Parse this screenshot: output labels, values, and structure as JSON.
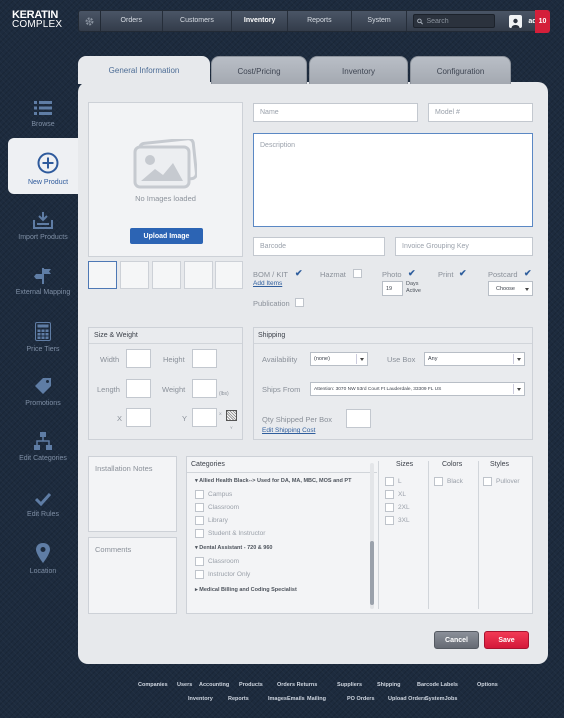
{
  "brand": {
    "line1": "KERATIN",
    "line2": "COMPLEX"
  },
  "nav": {
    "items": [
      "Orders",
      "Customers",
      "Inventory",
      "Reports",
      "System"
    ],
    "active": "Inventory",
    "search_placeholder": "Search",
    "user": "admin",
    "notifications": "10"
  },
  "sidebar": {
    "items": [
      {
        "label": "Browse",
        "icon": "list-icon"
      },
      {
        "label": "New Product",
        "icon": "plus-circle-icon"
      },
      {
        "label": "Import Products",
        "icon": "import-icon"
      },
      {
        "label": "External Mapping",
        "icon": "signpost-icon"
      },
      {
        "label": "Price Tiers",
        "icon": "calculator-icon"
      },
      {
        "label": "Promotions",
        "icon": "tag-icon"
      },
      {
        "label": "Edit Categories",
        "icon": "hierarchy-icon"
      },
      {
        "label": "Edit Rules",
        "icon": "check-icon"
      },
      {
        "label": "Location",
        "icon": "map-pin-icon"
      }
    ],
    "active": "New Product"
  },
  "tabs": [
    "General Information",
    "Cost/Pricing",
    "Inventory",
    "Configuration"
  ],
  "image": {
    "empty_text": "No Images loaded",
    "upload_label": "Upload Image"
  },
  "fields": {
    "name": "Name",
    "model": "Model #",
    "description": "Description",
    "barcode": "Barcode",
    "invoice_key": "Invoice Grouping Key"
  },
  "flags": {
    "bom": "BOM / KIT",
    "add_items": "Add Items",
    "hazmat": "Hazmat",
    "photo": "Photo",
    "days": "19",
    "days_label1": "Days",
    "days_label2": "Active",
    "print": "Print",
    "postcard": "Postcard",
    "choose": "Choose",
    "publication": "Publication"
  },
  "size": {
    "title": "Size & Weight",
    "width": "Width",
    "height": "Height",
    "length": "Length",
    "weight": "Weight",
    "weight_unit": "(lbs)",
    "x1": "X",
    "y": "Y",
    "x2": "X",
    "y2": "Y"
  },
  "shipping": {
    "title": "Shipping",
    "availability": "Availability",
    "availability_value": "(none)",
    "use_box": "Use Box",
    "use_box_value": "Any",
    "ships_from": "Ships From",
    "ships_from_value": "Attention: 3070 NW 53rd Court Ft Lauderdale, 33309 FL US",
    "qty": "Qty  Shipped Per Box",
    "edit_cost": "Edit Shipping Cost"
  },
  "notes": {
    "installation": "Installation Notes",
    "comments": "Comments"
  },
  "categories": {
    "title": "Categories",
    "group1": "Allied Health Black--> Used for DA, MA, MBC, MOS and PT",
    "group1_items": [
      "Campus",
      "Classroom",
      "Library",
      "Student & Instructor"
    ],
    "group2": "Dental Assistant - 720 & 960",
    "group2_items": [
      "Classroom",
      "Instructor Only"
    ],
    "group3": "Medical Billing and Coding Specialist"
  },
  "sizes": {
    "title": "Sizes",
    "items": [
      "L",
      "XL",
      "2XL",
      "3XL"
    ]
  },
  "colors": {
    "title": "Colors",
    "items": [
      "Black"
    ]
  },
  "styles": {
    "title": "Styles",
    "items": [
      "Pullover"
    ]
  },
  "actions": {
    "cancel": "Cancel",
    "save": "Save"
  },
  "footer": {
    "row1": [
      "Companies",
      "Users",
      "Accounting",
      "Products",
      "Orders Returns",
      "Suppliers",
      "Shipping",
      "Barcode Labels",
      "Options"
    ],
    "row2": [
      "Inventory",
      "Reports",
      "Images",
      "Emails",
      "Mailing",
      "PO Orders",
      "Upload Orders",
      "SystemJobs"
    ]
  },
  "colors_theme": {
    "accent": "#2f5e9d",
    "danger": "#e3203f",
    "background": "#1d2b3e"
  }
}
